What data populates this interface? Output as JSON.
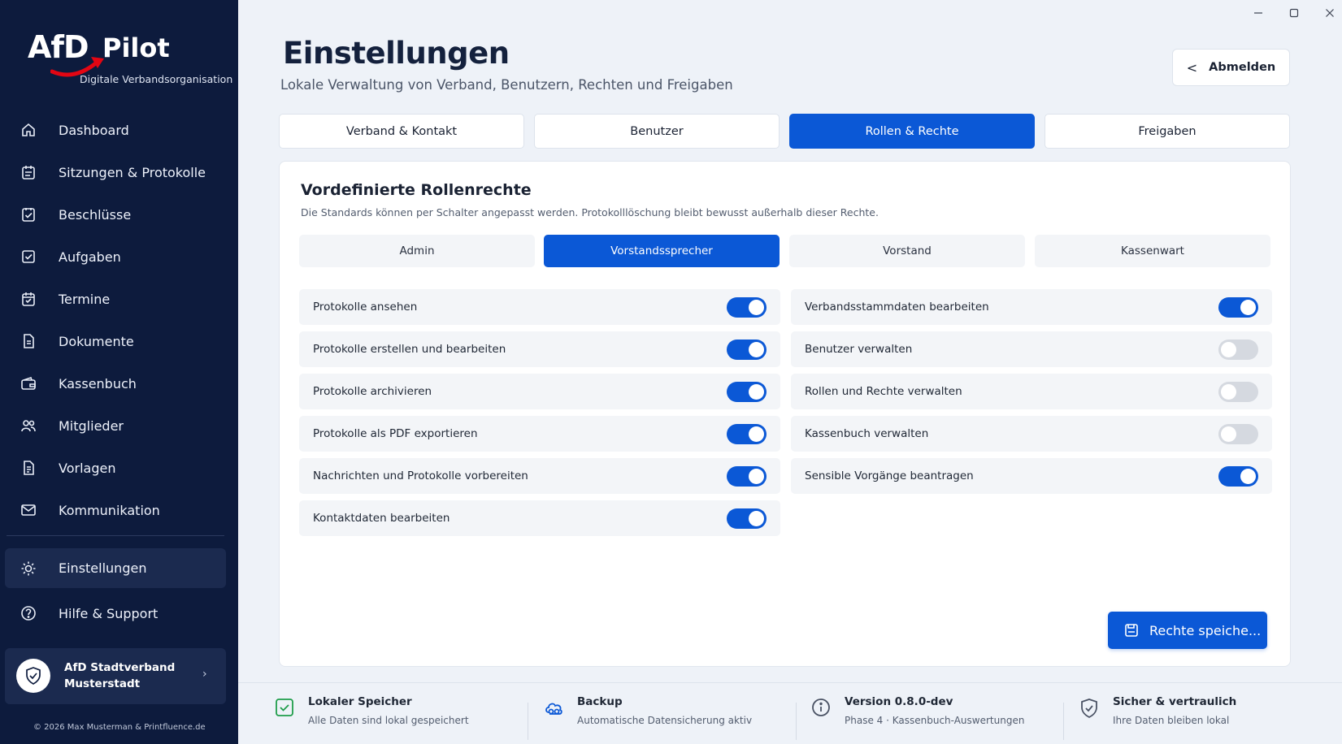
{
  "window": {
    "minimize_icon": "minimize-icon",
    "maximize_icon": "maximize-icon",
    "close_icon": "close-icon"
  },
  "brand": {
    "logo_text": "AfD",
    "product": "Pilot",
    "tagline": "Digitale Verbandsorganisation"
  },
  "sidebar": {
    "items": [
      {
        "label": "Dashboard",
        "icon": "home-icon"
      },
      {
        "label": "Sitzungen & Protokolle",
        "icon": "calendar-list-icon"
      },
      {
        "label": "Beschlüsse",
        "icon": "check-document-icon"
      },
      {
        "label": "Aufgaben",
        "icon": "checkbox-icon"
      },
      {
        "label": "Termine",
        "icon": "calendar-icon"
      },
      {
        "label": "Dokumente",
        "icon": "document-icon"
      },
      {
        "label": "Kassenbuch",
        "icon": "wallet-icon"
      },
      {
        "label": "Mitglieder",
        "icon": "users-icon"
      },
      {
        "label": "Vorlagen",
        "icon": "template-icon"
      },
      {
        "label": "Kommunikation",
        "icon": "mail-icon"
      }
    ],
    "active": {
      "label": "Einstellungen",
      "icon": "gear-icon"
    },
    "help": {
      "label": "Hilfe & Support",
      "icon": "help-icon"
    },
    "org": {
      "name": "AfD Stadtverband Musterstadt",
      "icon": "shield-icon"
    },
    "copyright": "© 2026 Max Musterman & Printfluence.de"
  },
  "header": {
    "title": "Einstellungen",
    "subtitle": "Lokale Verwaltung von Verband, Benutzern, Rechten und Freigaben",
    "logout_label": "Abmelden"
  },
  "tabs": [
    {
      "label": "Verband & Kontakt",
      "active": false
    },
    {
      "label": "Benutzer",
      "active": false
    },
    {
      "label": "Rollen & Rechte",
      "active": true
    },
    {
      "label": "Freigaben",
      "active": false
    }
  ],
  "card": {
    "title": "Vordefinierte Rollenrechte",
    "description": "Die Standards können per Schalter angepasst werden. Protokolllöschung bleibt bewusst außerhalb dieser Rechte.",
    "roles": [
      {
        "label": "Admin",
        "active": false
      },
      {
        "label": "Vorstandssprecher",
        "active": true
      },
      {
        "label": "Vorstand",
        "active": false
      },
      {
        "label": "Kassenwart",
        "active": false
      }
    ],
    "permissions_left": [
      {
        "label": "Protokolle ansehen",
        "enabled": true
      },
      {
        "label": "Protokolle erstellen und bearbeiten",
        "enabled": true
      },
      {
        "label": "Protokolle archivieren",
        "enabled": true
      },
      {
        "label": "Protokolle als PDF exportieren",
        "enabled": true
      },
      {
        "label": "Nachrichten und Protokolle vorbereiten",
        "enabled": true
      },
      {
        "label": "Kontaktdaten bearbeiten",
        "enabled": true
      }
    ],
    "permissions_right": [
      {
        "label": "Verbandsstammdaten bearbeiten",
        "enabled": true
      },
      {
        "label": "Benutzer verwalten",
        "enabled": false
      },
      {
        "label": "Rollen und Rechte verwalten",
        "enabled": false
      },
      {
        "label": "Kassenbuch verwalten",
        "enabled": false
      },
      {
        "label": "Sensible Vorgänge beantragen",
        "enabled": true
      }
    ],
    "save_label": "Rechte speiche..."
  },
  "footer": [
    {
      "title": "Lokaler Speicher",
      "subtitle": "Alle Daten sind lokal gespeichert",
      "icon": "check-square-icon"
    },
    {
      "title": "Backup",
      "subtitle": "Automatische Datensicherung aktiv",
      "icon": "cloud-sync-icon"
    },
    {
      "title": "Version 0.8.0-dev",
      "subtitle": "Phase 4 · Kassenbuch-Auswertungen",
      "icon": "info-icon"
    },
    {
      "title": "Sicher & vertraulich",
      "subtitle": "Ihre Daten bleiben lokal",
      "icon": "shield-check-icon"
    }
  ],
  "colors": {
    "sidebar_bg": "#0d1b3d",
    "accent": "#0b58d6",
    "page_bg": "#eef2f8",
    "brand_red": "#e30613"
  }
}
